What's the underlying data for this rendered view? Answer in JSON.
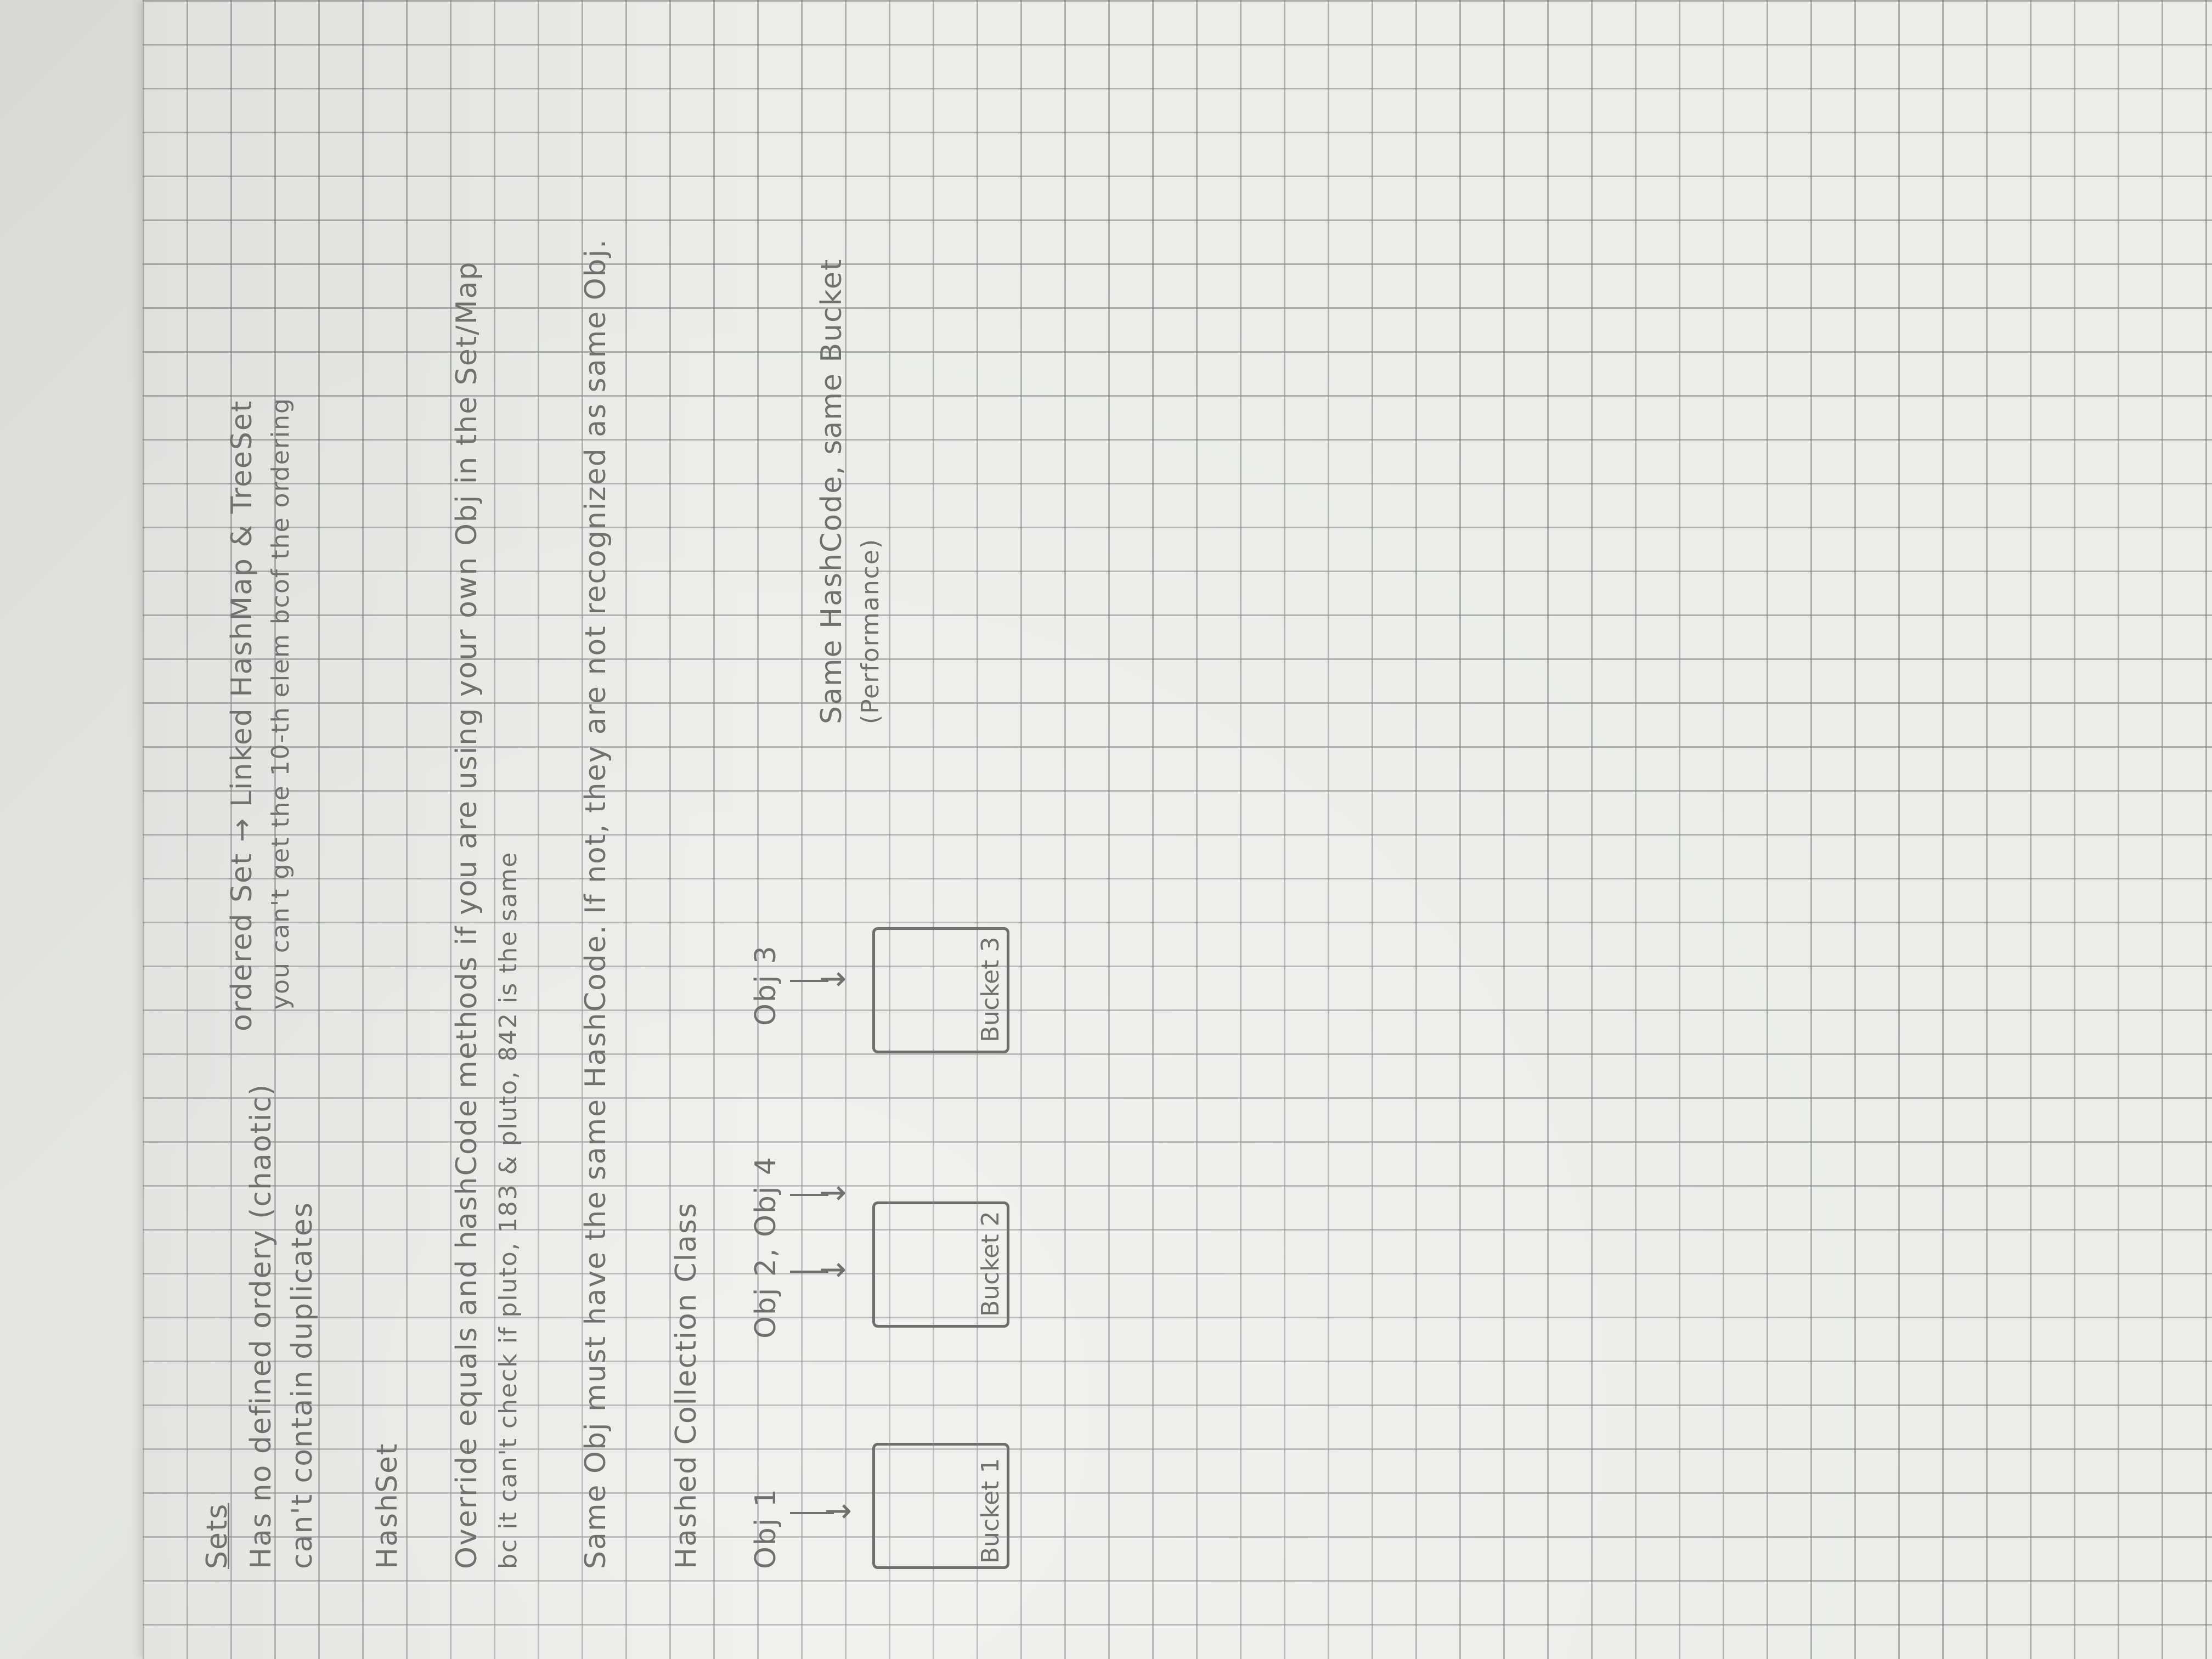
{
  "notes": {
    "sets_title": "Sets",
    "sets_line1": "Has no defined ordery (chaotic)",
    "sets_line2": "can't contain duplicates",
    "ordered_set": "ordered Set → Linked HashMap & TreeSet",
    "ordered_note": "you can't get the 10-th elem bcof the ordering",
    "hashset_title": "HashSet",
    "override_line1": "Override equals and hashCode methods if you are using your own Obj in the Set/Map",
    "override_line2": "bc it can't check if pluto, 183 & pluto, 842 is the same",
    "same_obj_line": "Same Obj must have the same HashCode. If not, they are not recognized as same Obj.",
    "hashed_title": "Hashed Collection Class",
    "obj1": "Obj 1",
    "obj2_obj4": "Obj 2, Obj 4",
    "obj3": "Obj 3",
    "same_hash_line1": "Same HashCode, same Bucket",
    "same_hash_line2": "(Performance)",
    "bucket1": "Bucket 1",
    "bucket2": "Bucket 2",
    "bucket3": "Bucket 3"
  },
  "colors": {
    "pencil": "#6e716d",
    "paper": "#ecedea",
    "grid": "#787e7a"
  }
}
